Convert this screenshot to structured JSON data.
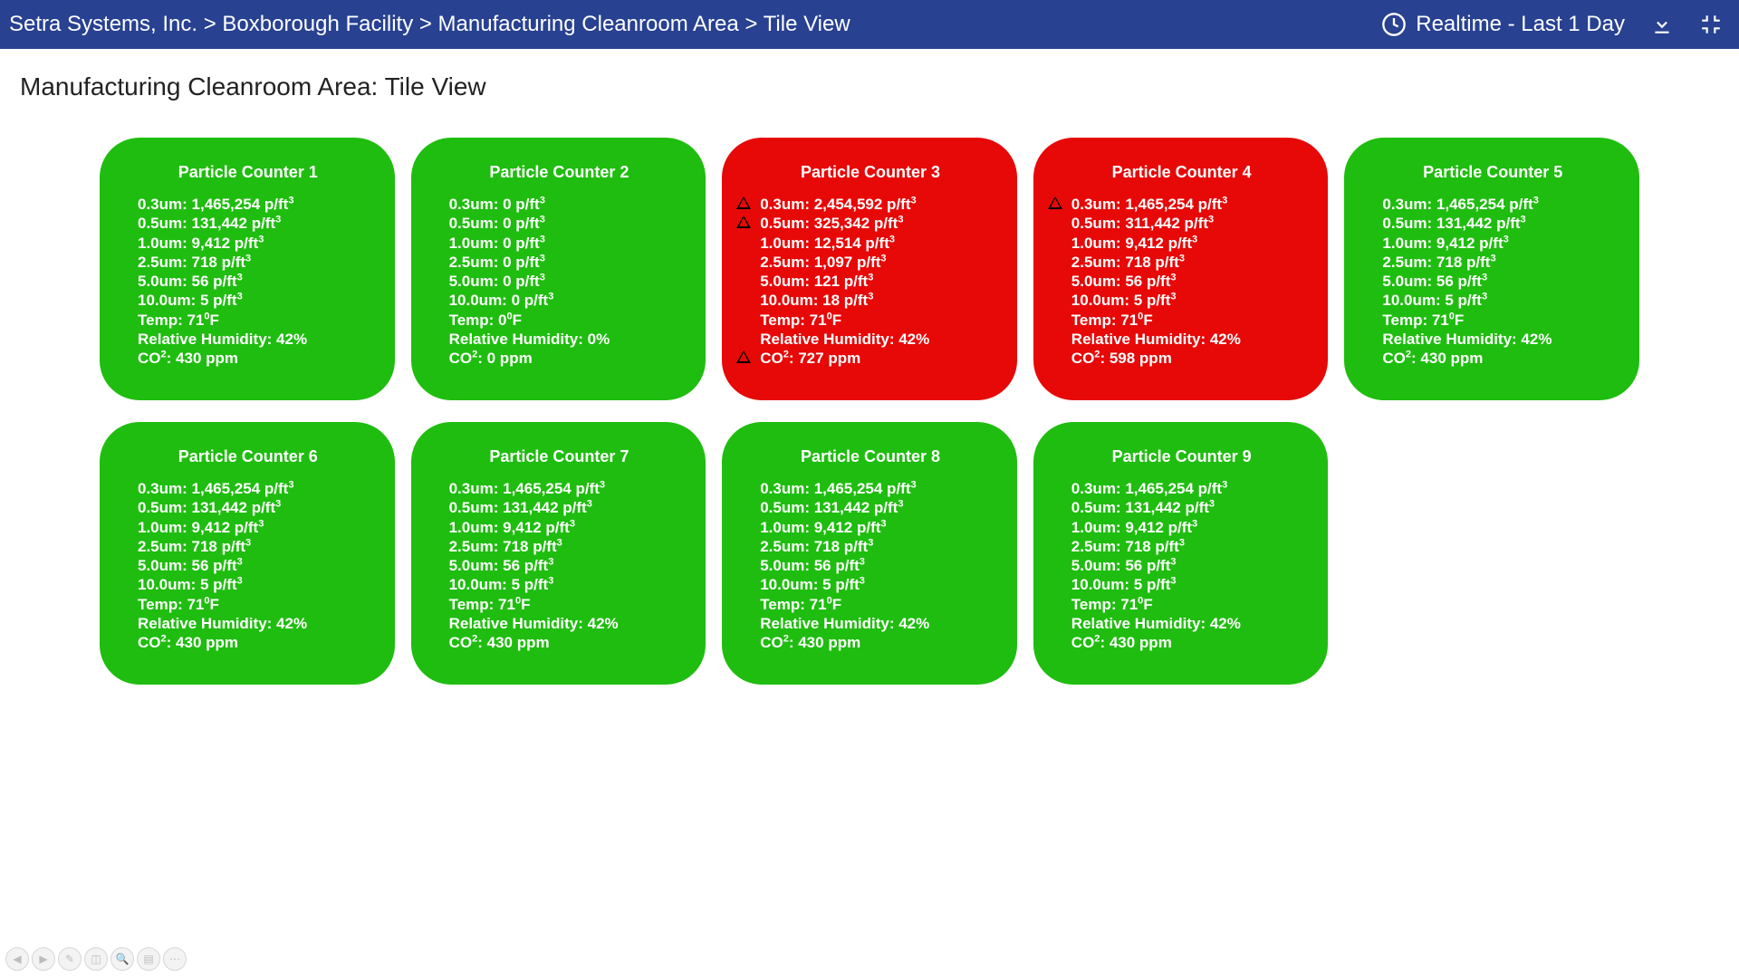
{
  "header": {
    "breadcrumb": "Setra Systems, Inc. > Boxborough Facility > Manufacturing Cleanroom Area > Tile View",
    "realtime_label": "Realtime - Last 1 Day"
  },
  "page_title": "Manufacturing Cleanroom Area: Tile View",
  "unit_labels": {
    "pft": "p/ft",
    "temp_prefix": "Temp: ",
    "rh_prefix": "Relative Humidity: ",
    "co2_prefix": "CO",
    "co2_suffix_unit": " ppm"
  },
  "tiles": [
    {
      "title": "Particle Counter 1",
      "status": "green",
      "small": false,
      "metrics": {
        "0.3um": "1,465,254",
        "0.5um": "131,442",
        "1.0um": "9,412",
        "2.5um": "718",
        "5.0um": "56",
        "10.0um": "5",
        "temp": "71",
        "rh": "42%",
        "co2": "430"
      },
      "warn": {}
    },
    {
      "title": "Particle Counter 2",
      "status": "green",
      "small": false,
      "metrics": {
        "0.3um": "0",
        "0.5um": "0",
        "1.0um": "0",
        "2.5um": "0",
        "5.0um": "0",
        "10.0um": "0",
        "temp": "0",
        "rh": "0%",
        "co2": "0"
      },
      "warn": {}
    },
    {
      "title": "Particle Counter 3",
      "status": "red",
      "small": false,
      "metrics": {
        "0.3um": "2,454,592",
        "0.5um": "325,342",
        "1.0um": "12,514",
        "2.5um": "1,097",
        "5.0um": "121",
        "10.0um": "18",
        "temp": "71",
        "rh": "42%",
        "co2": "727"
      },
      "warn": {
        "0.3um": true,
        "0.5um": true,
        "co2": true
      }
    },
    {
      "title": "Particle Counter 4",
      "status": "red",
      "small": false,
      "metrics": {
        "0.3um": "1,465,254",
        "0.5um": "311,442",
        "1.0um": "9,412",
        "2.5um": "718",
        "5.0um": "56",
        "10.0um": "5",
        "temp": "71",
        "rh": "42%",
        "co2": "598"
      },
      "warn": {
        "0.3um": true
      }
    },
    {
      "title": "Particle Counter 5",
      "status": "green",
      "small": true,
      "metrics": {
        "0.3um": "1,465,254",
        "0.5um": "131,442",
        "1.0um": "9,412",
        "2.5um": "718",
        "5.0um": "56",
        "10.0um": "5",
        "temp": "71",
        "rh": "42%",
        "co2": "430"
      },
      "warn": {}
    },
    {
      "title": "Particle Counter 6",
      "status": "green",
      "small": false,
      "metrics": {
        "0.3um": "1,465,254",
        "0.5um": "131,442",
        "1.0um": "9,412",
        "2.5um": "718",
        "5.0um": "56",
        "10.0um": "5",
        "temp": "71",
        "rh": "42%",
        "co2": "430"
      },
      "warn": {}
    },
    {
      "title": "Particle Counter 7",
      "status": "green",
      "small": false,
      "metrics": {
        "0.3um": "1,465,254",
        "0.5um": "131,442",
        "1.0um": "9,412",
        "2.5um": "718",
        "5.0um": "56",
        "10.0um": "5",
        "temp": "71",
        "rh": "42%",
        "co2": "430"
      },
      "warn": {}
    },
    {
      "title": "Particle Counter 8",
      "status": "green",
      "small": false,
      "metrics": {
        "0.3um": "1,465,254",
        "0.5um": "131,442",
        "1.0um": "9,412",
        "2.5um": "718",
        "5.0um": "56",
        "10.0um": "5",
        "temp": "71",
        "rh": "42%",
        "co2": "430"
      },
      "warn": {}
    },
    {
      "title": "Particle Counter 9",
      "status": "green",
      "small": false,
      "metrics": {
        "0.3um": "1,465,254",
        "0.5um": "131,442",
        "1.0um": "9,412",
        "2.5um": "718",
        "5.0um": "56",
        "10.0um": "5",
        "temp": "71",
        "rh": "42%",
        "co2": "430"
      },
      "warn": {}
    }
  ],
  "particle_sizes": [
    "0.3um",
    "0.5um",
    "1.0um",
    "2.5um",
    "5.0um",
    "10.0um"
  ]
}
